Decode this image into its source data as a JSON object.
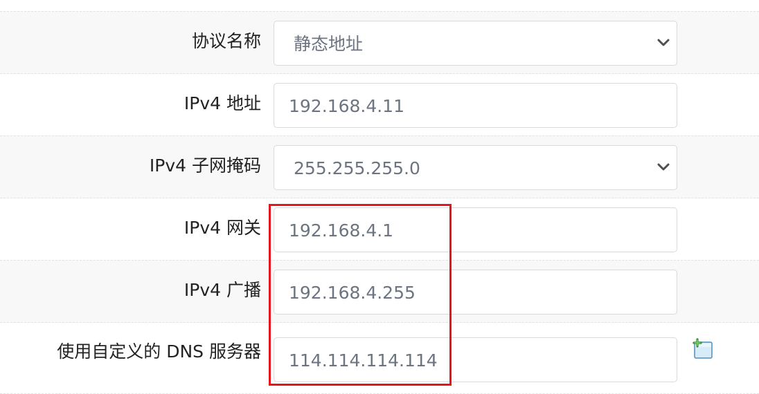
{
  "form": {
    "protocol": {
      "label": "协议名称",
      "value": "静态地址"
    },
    "ipv4_address": {
      "label": "IPv4 地址",
      "value": "192.168.4.11"
    },
    "ipv4_netmask": {
      "label": "IPv4 子网掩码",
      "value": "255.255.255.0"
    },
    "ipv4_gateway": {
      "label": "IPv4 网关",
      "value": "192.168.4.1"
    },
    "ipv4_broadcast": {
      "label": "IPv4 广播",
      "value": "192.168.4.255"
    },
    "custom_dns": {
      "label": "使用自定义的 DNS 服务器",
      "value": "114.114.114.114",
      "add_icon": "add-entry-icon"
    }
  },
  "highlight_color": "#e8141b"
}
